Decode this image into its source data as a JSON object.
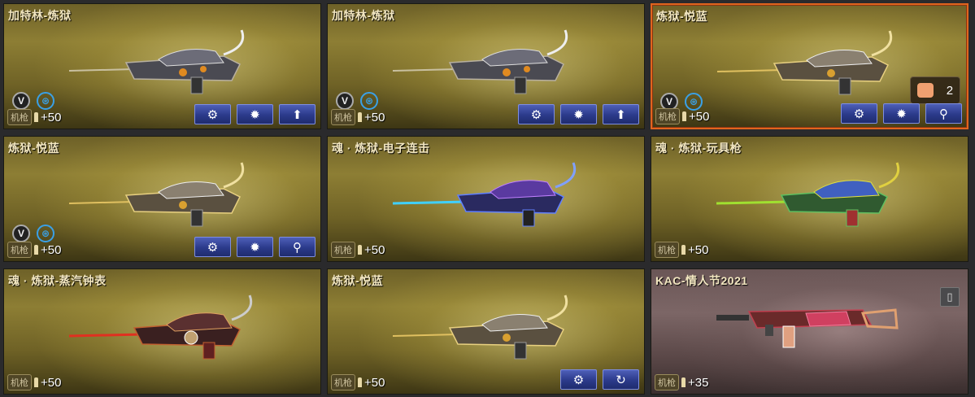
{
  "cards": [
    {
      "title": "加特林-炼狱",
      "type": "机枪",
      "ammo": "+50",
      "badges": true,
      "actions": [
        "gear-wrench",
        "gear",
        "up"
      ]
    },
    {
      "title": "加特林-炼狱",
      "type": "机枪",
      "ammo": "+50",
      "badges": true,
      "actions": [
        "gear-wrench",
        "gear",
        "up"
      ]
    },
    {
      "title": "炼狱-悦蓝",
      "type": "机枪",
      "ammo": "+50",
      "badges": true,
      "stock_count": "2",
      "actions": [
        "gear-wrench",
        "gear",
        "search"
      ]
    },
    {
      "title": "炼狱-悦蓝",
      "type": "机枪",
      "ammo": "+50",
      "badges": true,
      "actions": [
        "gear-wrench",
        "gear",
        "search"
      ]
    },
    {
      "title": "魂 · 炼狱-电子连击",
      "type": "机枪",
      "ammo": "+50",
      "badges": false,
      "actions": []
    },
    {
      "title": "魂 · 炼狱-玩具枪",
      "type": "机枪",
      "ammo": "+50",
      "badges": false,
      "actions": []
    },
    {
      "title": "魂 · 炼狱-蒸汽钟表",
      "type": "机枪",
      "ammo": "+50",
      "badges": false,
      "actions": []
    },
    {
      "title": "炼狱-悦蓝",
      "type": "机枪",
      "ammo": "+50",
      "badges": false,
      "actions": [
        "gear-wrench",
        "refresh"
      ]
    },
    {
      "title": "KAC-情人节2021",
      "type": "机枪",
      "ammo": "+35",
      "badges": false,
      "actions": []
    }
  ],
  "icons": {
    "gear-wrench": "⚙",
    "gear": "✹",
    "up": "⬆",
    "search": "⚲",
    "refresh": "↻",
    "trash": "🗑"
  },
  "colors": {
    "selected_border": "#e0641e",
    "button_blue": "#2b3a8a",
    "title_text": "#f2e6c0"
  }
}
